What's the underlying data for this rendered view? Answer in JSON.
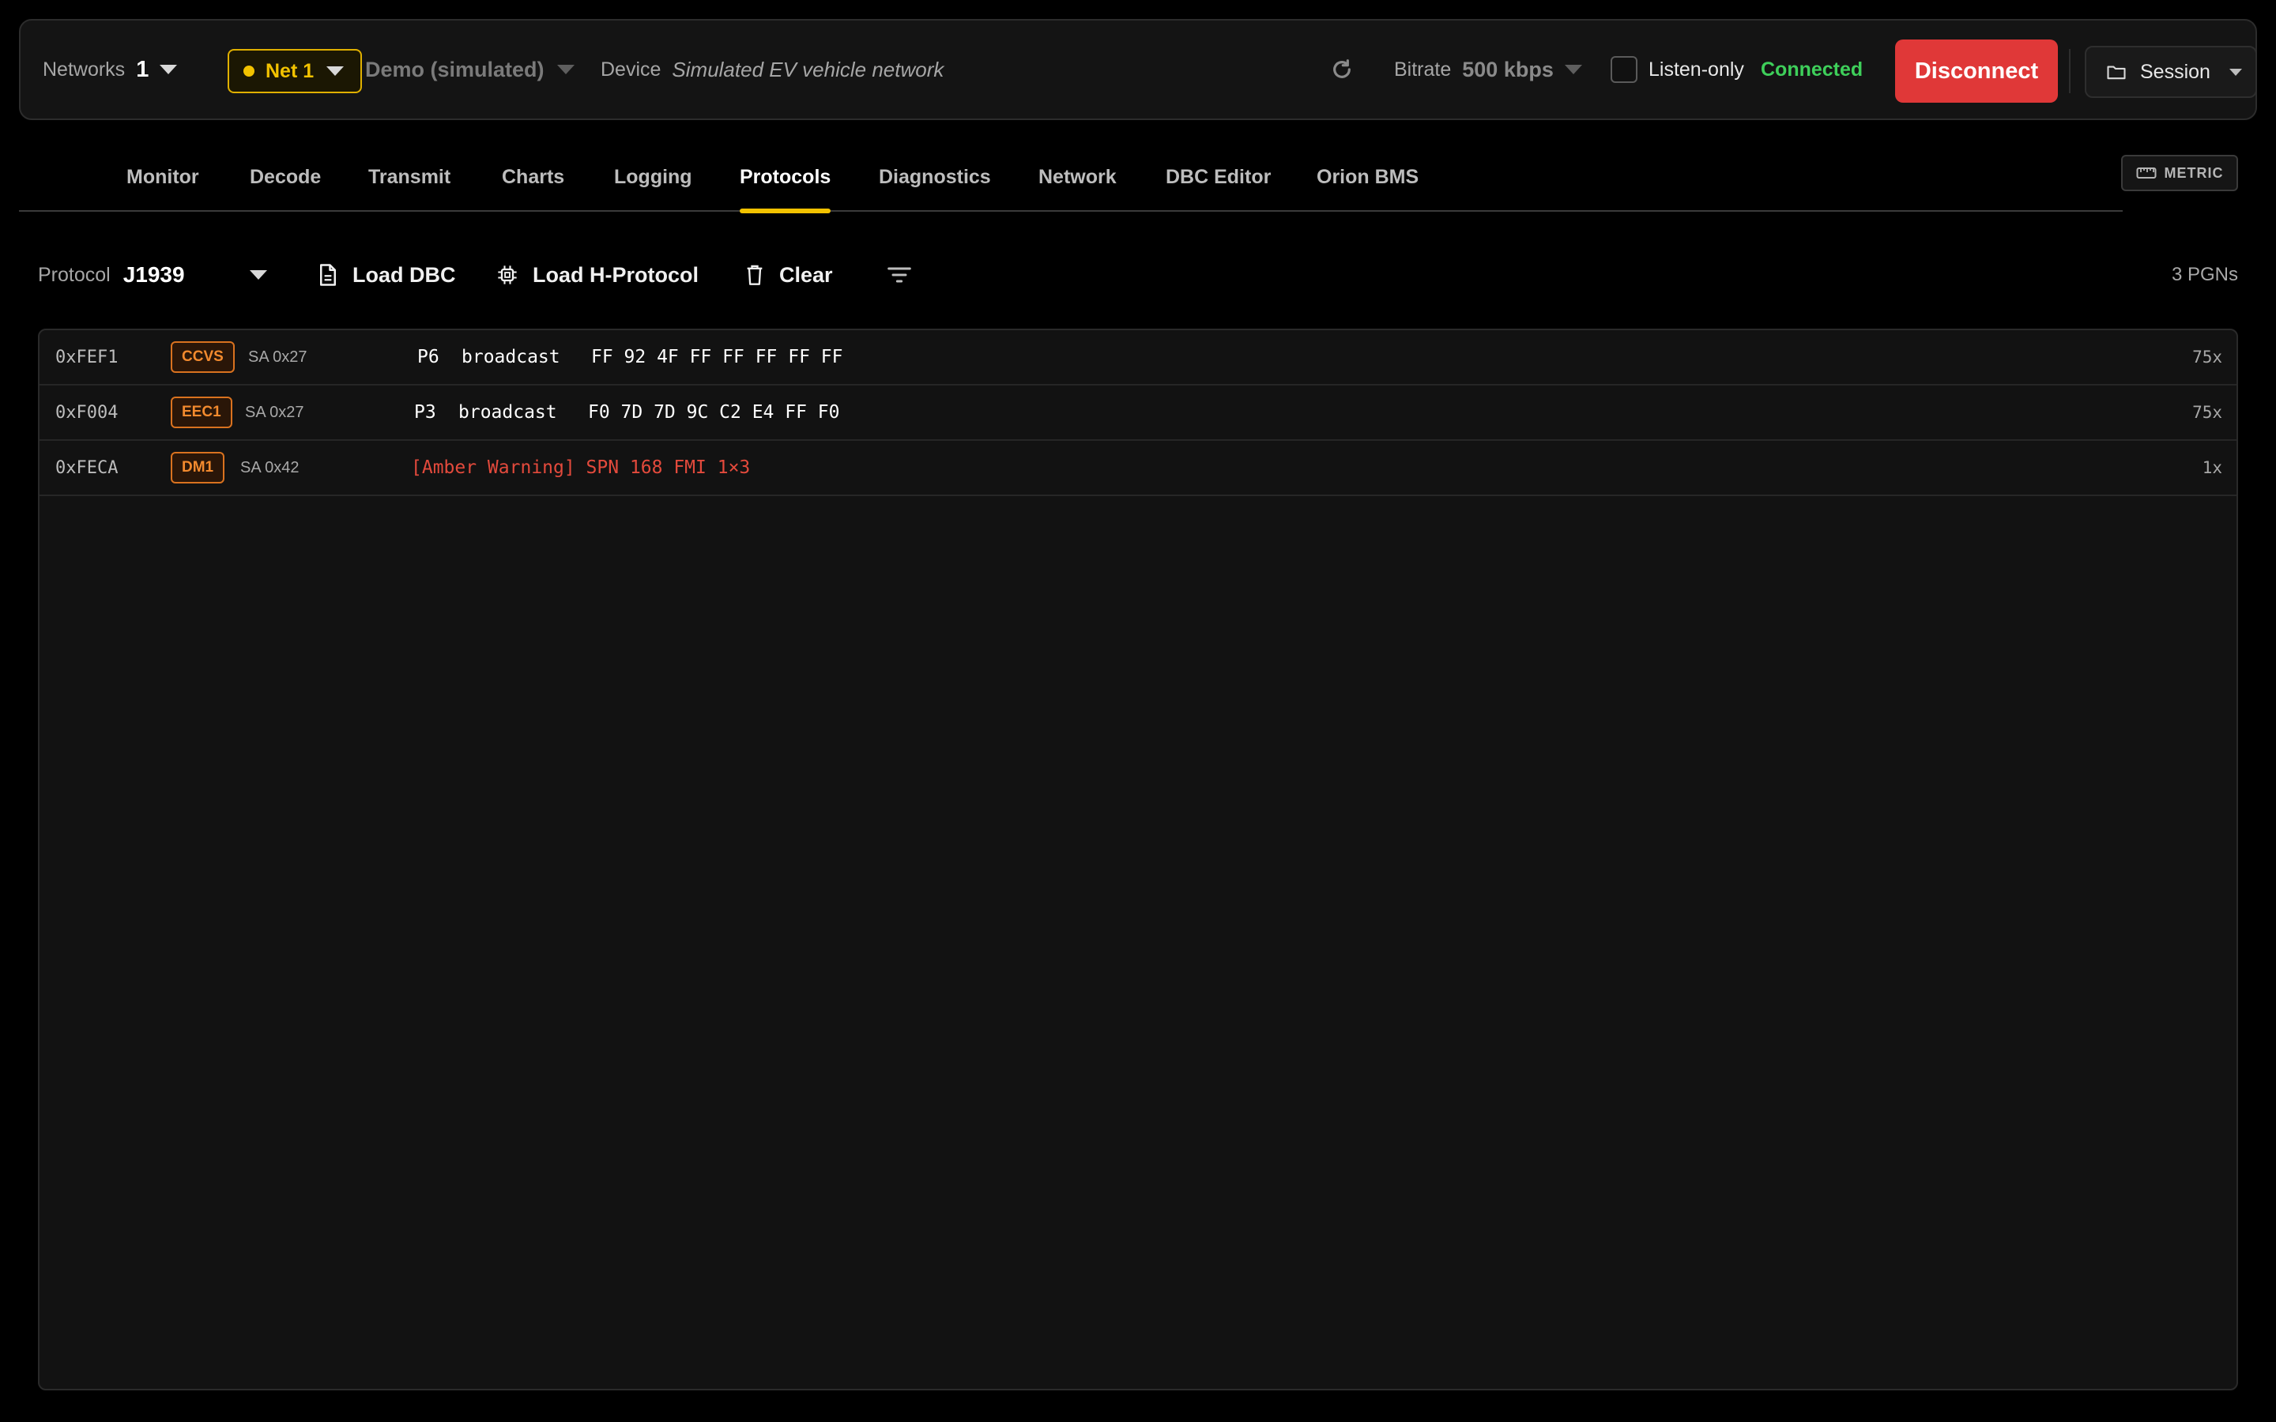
{
  "topbar": {
    "networks_label": "Networks",
    "networks_count": "1",
    "net_label": "Net 1",
    "mode_label": "Demo (simulated)",
    "device_label": "Device",
    "device_value": "Simulated EV vehicle network",
    "bitrate_label": "Bitrate",
    "bitrate_value": "500 kbps",
    "listen_only_label": "Listen-only",
    "listen_only_checked": false,
    "status_text": "Connected",
    "disconnect_label": "Disconnect",
    "session_label": "Session"
  },
  "tabs": [
    {
      "label": "Monitor"
    },
    {
      "label": "Decode"
    },
    {
      "label": "Transmit"
    },
    {
      "label": "Charts"
    },
    {
      "label": "Logging"
    },
    {
      "label": "Protocols",
      "active": true
    },
    {
      "label": "Diagnostics"
    },
    {
      "label": "Network"
    },
    {
      "label": "DBC Editor"
    },
    {
      "label": "Orion BMS"
    }
  ],
  "metric_label": "METRIC",
  "protocol_bar": {
    "protocol_label": "Protocol",
    "protocol_value": "J1939",
    "load_dbc_label": "Load DBC",
    "load_hprotocol_label": "Load H-Protocol",
    "clear_label": "Clear",
    "pgn_count": "3 PGNs"
  },
  "rows": [
    {
      "pgn": "0xFEF1",
      "name": "CCVS",
      "sa": "SA 0x27",
      "priority": "P6",
      "dest": "broadcast",
      "data": "FF 92 4F FF FF FF FF FF",
      "count": "75x"
    },
    {
      "pgn": "0xF004",
      "name": "EEC1",
      "sa": "SA 0x27",
      "priority": "P3",
      "dest": "broadcast",
      "data": "F0 7D 7D 9C C2 E4 FF F0",
      "count": "75x"
    },
    {
      "pgn": "0xFECA",
      "name": "DM1",
      "sa": "SA 0x42",
      "warning": "[Amber Warning] SPN 168 FMI 1×3",
      "count": "1x"
    }
  ],
  "colors": {
    "accent": "#f2c200",
    "danger": "#e03838",
    "connected": "#3ecf5a",
    "badge": "#f28a2e",
    "warning_text": "#e34a3c"
  }
}
